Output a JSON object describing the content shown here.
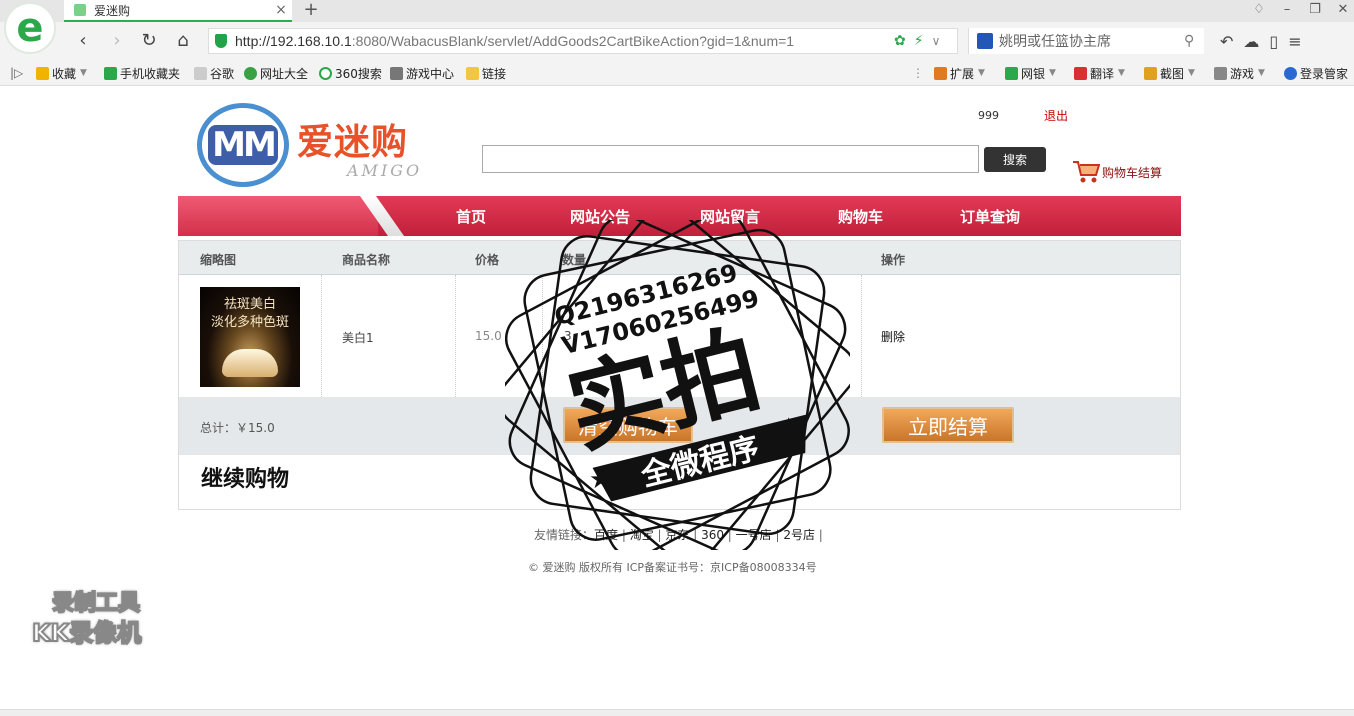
{
  "browser": {
    "tab_title": "爱迷购",
    "tab_close": "×",
    "new_tab": "+",
    "url_host": "http://192.168.10.1",
    "url_rest": ":8080/WabacusBlank/servlet/AddGoods2CartBikeAction?gid=1&num=1",
    "search_text": "姚明或任篮协主席",
    "bookmarks": [
      {
        "label": "收藏",
        "color": "#f0b400"
      },
      {
        "label": "手机收藏夹",
        "color": "#2aa84a"
      },
      {
        "label": "谷歌",
        "color": "#999999"
      },
      {
        "label": "网址大全",
        "color": "#3aa044"
      },
      {
        "label": "360搜索",
        "color": "#2aa84a"
      },
      {
        "label": "游戏中心",
        "color": "#777777"
      },
      {
        "label": "链接",
        "color": "#f4c542"
      }
    ],
    "right_bookmarks": [
      {
        "label": "扩展",
        "color": "#e07a20"
      },
      {
        "label": "网银",
        "color": "#2aa84a"
      },
      {
        "label": "翻译",
        "color": "#d83030"
      },
      {
        "label": "截图",
        "color": "#e0a020"
      },
      {
        "label": "游戏",
        "color": "#888888"
      },
      {
        "label": "登录管家",
        "color": "#2a6ad0"
      }
    ]
  },
  "site": {
    "logo_mm": "MM",
    "brand_cn": "爱迷购",
    "brand_en": "AMIGO",
    "user_name": "999",
    "logout": "退出",
    "search_button": "搜索",
    "cart_link": "购物车结算",
    "nav": [
      "首页",
      "网站公告",
      "网站留言",
      "购物车",
      "订单查询"
    ]
  },
  "cart": {
    "headers": [
      "缩略图",
      "商品名称",
      "价格",
      "数量",
      "操作"
    ],
    "rows": [
      {
        "image_text_1": "祛斑美白",
        "image_text_2": "淡化多种色斑",
        "name": "美白1",
        "price": "15.0",
        "quantity": "3",
        "action": "删除"
      }
    ],
    "total": "总计：￥15.0",
    "clear_button": "清空购物车",
    "checkout_button": "立即结算",
    "continue_shopping": "继续购物"
  },
  "footer": {
    "friend_label": "友情链接：",
    "links": [
      "百度",
      "淘宝",
      "京东",
      "360",
      "一号店",
      "2号店"
    ],
    "copyright": "© 爱迷购 版权所有 ICP备案证书号：京ICP备08008334号"
  },
  "watermark": {
    "line1": "Q2196316269",
    "line2": "V17060256499",
    "big": "实拍",
    "ribbon": "全微程序"
  },
  "recorder_badge": {
    "line1": "录制工具",
    "line2": "KK录像机"
  }
}
